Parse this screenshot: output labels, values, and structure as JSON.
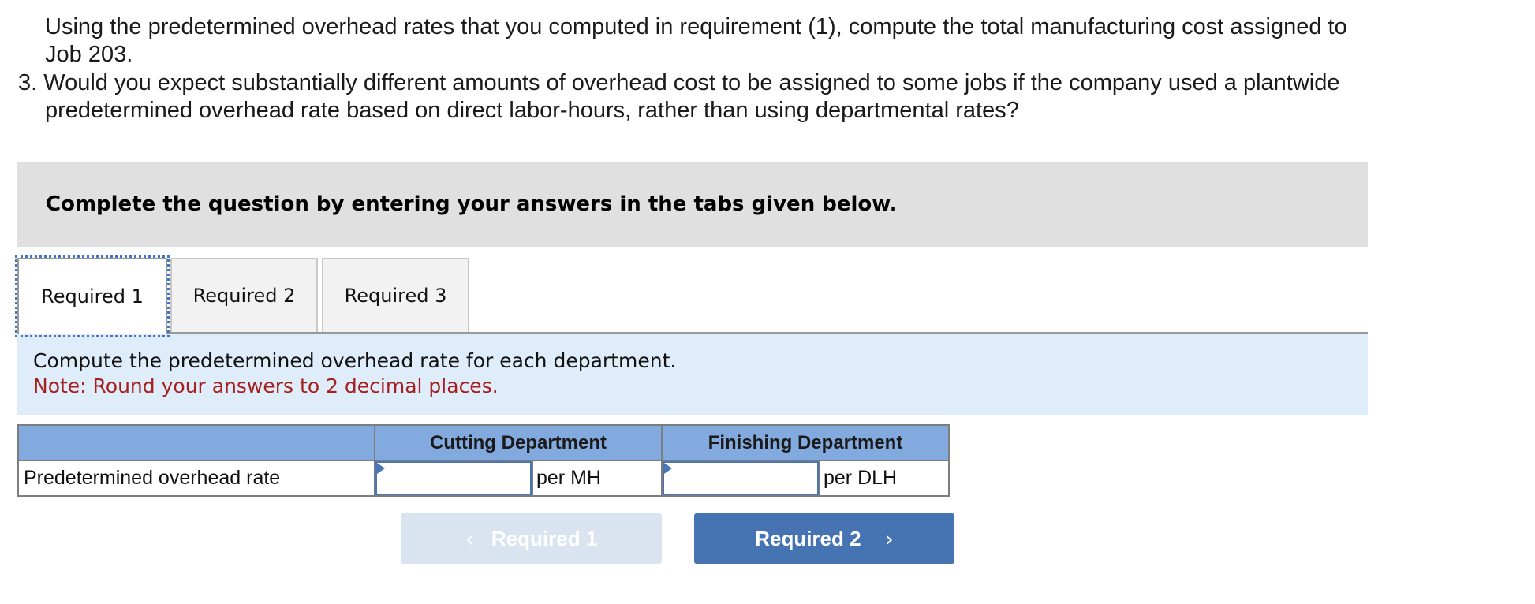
{
  "question": {
    "lines": [
      "Using the predetermined overhead rates that you computed in requirement (1), compute the total manufacturing cost assigned to",
      "Job 203.",
      "3. Would you expect substantially different amounts of overhead cost to be assigned to some jobs if the company used a plantwide",
      "predetermined overhead rate based on direct labor-hours, rather than using departmental rates?"
    ]
  },
  "instructions": "Complete the question by entering your answers in the tabs given below.",
  "tabs": [
    {
      "label": "Required 1",
      "active": true
    },
    {
      "label": "Required 2",
      "active": false
    },
    {
      "label": "Required 3",
      "active": false
    }
  ],
  "task": {
    "prompt": "Compute the predetermined overhead rate for each department.",
    "note": "Note: Round your answers to 2 decimal places."
  },
  "table": {
    "headers": [
      "",
      "Cutting Department",
      "Finishing Department"
    ],
    "rows": [
      {
        "label": "Predetermined overhead rate",
        "cutting": {
          "value": "",
          "unit": "per MH"
        },
        "finishing": {
          "value": "",
          "unit": "per DLH"
        }
      }
    ]
  },
  "nav": {
    "prev": {
      "label": "Required 1",
      "icon": "chevron-left-icon",
      "glyph": "‹",
      "disabled": true
    },
    "next": {
      "label": "Required 2",
      "icon": "chevron-right-icon",
      "glyph": "›",
      "disabled": false
    }
  },
  "colors": {
    "instruction_bg": "#e0e0e0",
    "task_bg": "#dfecf9",
    "note_red": "#a4201d",
    "table_header": "#82aadf",
    "btn_primary": "#4673b2",
    "btn_disabled": "#dae4f0",
    "focus_outline": "#4472c4"
  }
}
